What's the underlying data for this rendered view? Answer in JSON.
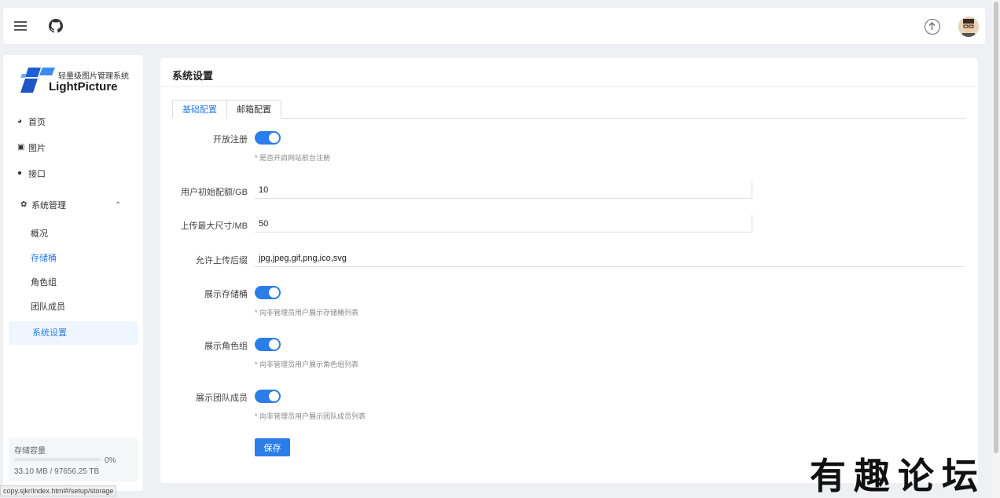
{
  "header": {
    "menu_icon": "hamburger-icon",
    "github_icon": "github-icon",
    "upload_icon": "upload-icon",
    "avatar_icon": "avatar"
  },
  "sidebar": {
    "logo_subtitle": "轻量级图片管理系统",
    "logo_title": "LightPicture",
    "items": [
      {
        "label": "首页",
        "icon": "dashboard-icon"
      },
      {
        "label": "图片",
        "icon": "image-icon"
      },
      {
        "label": "接口",
        "icon": "api-icon"
      },
      {
        "label": "系统管理",
        "icon": "gear-icon"
      }
    ],
    "sub_items": [
      {
        "label": "概况"
      },
      {
        "label": "存储桶"
      },
      {
        "label": "角色组"
      },
      {
        "label": "团队成员"
      },
      {
        "label": "系统设置"
      }
    ],
    "storage": {
      "label": "存储容量",
      "percent": "0%",
      "size": "33.10 MB / 97656.25 TB"
    }
  },
  "main": {
    "title": "系统设置",
    "tabs": [
      {
        "label": "基础配置"
      },
      {
        "label": "邮箱配置"
      }
    ],
    "fields": {
      "register_label": "开放注册",
      "register_hint": "* 是否开启网站前台注册",
      "quota_label": "用户初始配额/GB",
      "quota_value": "10",
      "max_size_label": "上传最大尺寸/MB",
      "max_size_value": "50",
      "formats_label": "允许上传后缀",
      "formats_value": "jpg,jpeg,gif,png,ico,svg",
      "show_storage_label": "展示存储桶",
      "show_storage_hint": "* 向非管理员用户展示存储桶列表",
      "show_roles_label": "展示角色组",
      "show_roles_hint": "* 向非管理员用户展示角色组列表",
      "show_team_label": "展示团队成员",
      "show_team_hint": "* 向非管理员用户展示团队成员列表"
    },
    "save_label": "保存"
  },
  "statusbar_url": "copy.sjkr/index.html#/setup/storage",
  "watermark": "有趣论坛",
  "colors": {
    "accent": "#2b7de9",
    "background": "#eef0f3"
  }
}
